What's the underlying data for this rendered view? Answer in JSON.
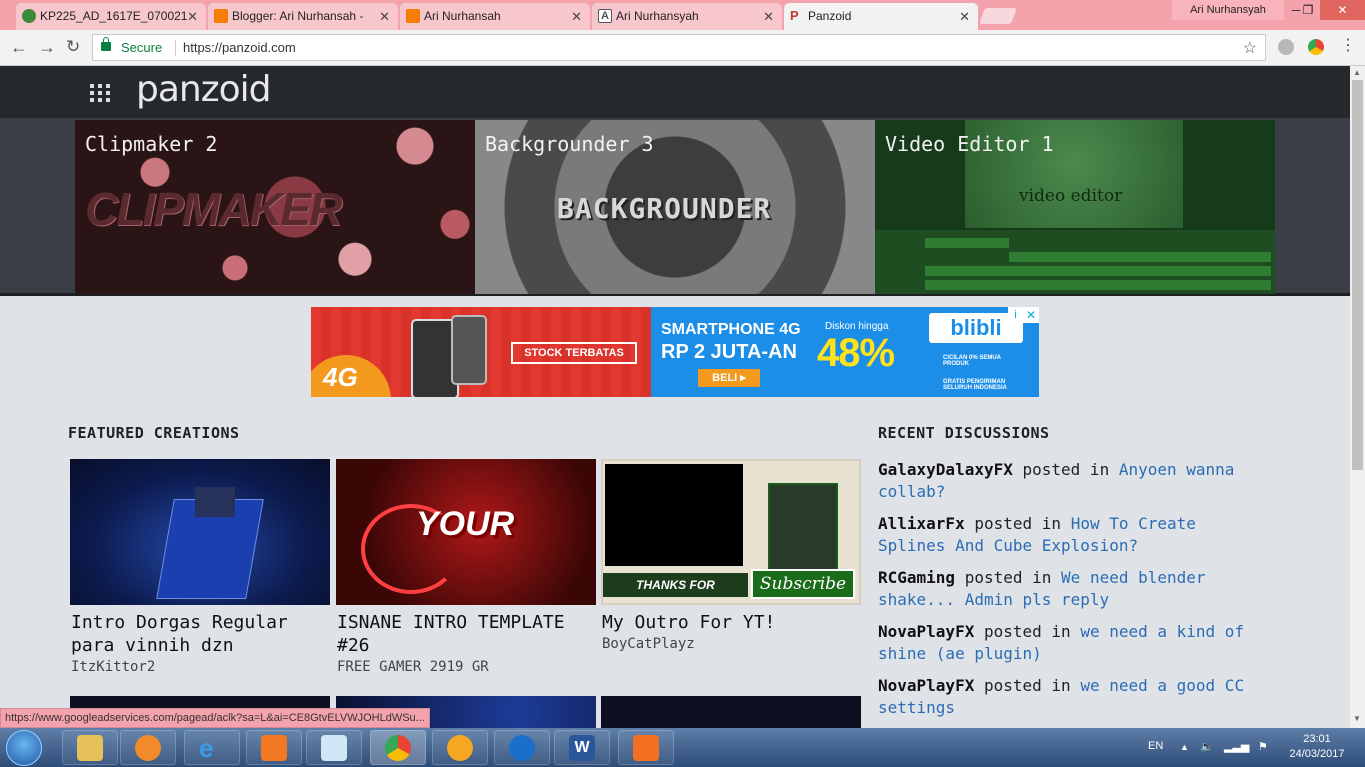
{
  "browser": {
    "tabs": [
      {
        "title": "KP225_AD_1617E_070021",
        "favicon": "moodle-favicon",
        "color": "#3a8a3a",
        "active": false
      },
      {
        "title": "Blogger: Ari Nurhansah -",
        "favicon": "blogger-favicon",
        "color": "#f57d00",
        "active": false
      },
      {
        "title": "Ari Nurhansah",
        "favicon": "blogger-favicon",
        "color": "#f57d00",
        "active": false
      },
      {
        "title": "Ari Nurhansyah",
        "favicon": "letter-a-favicon",
        "color": "#555555",
        "active": false
      },
      {
        "title": "Panzoid",
        "favicon": "panzoid-favicon",
        "color": "#c0392b",
        "active": true
      }
    ],
    "profile_name": "Ari Nurhansyah",
    "secure_label": "Secure",
    "url": "https://panzoid.com"
  },
  "site": {
    "logo": "panzoid",
    "tools": [
      {
        "title": "Clipmaker 2",
        "art_text": "CLIPMAKER"
      },
      {
        "title": "Backgrounder 3",
        "art_text": "BACKGROUNDER"
      },
      {
        "title": "Video Editor 1",
        "art_text": "video editor"
      }
    ]
  },
  "ad": {
    "badge": "4G",
    "stock": "STOCK TERBATAS",
    "headline1": "SMARTPHONE 4G",
    "headline2": "RP 2 JUTA-AN",
    "discount_label": "Diskon hingga",
    "discount": "48%",
    "cta": "BELI ▸",
    "brand": "blibli",
    "feature1": "CICILAN 0% SEMUA PRODUK",
    "feature2": "GRATIS PENGIRIMAN SELURUH INDONESIA",
    "info_icon": "i",
    "close_icon": "✕"
  },
  "featured": {
    "heading": "FEATURED CREATIONS",
    "cards": [
      {
        "title": "Intro Dorgas Regular para vinnih dzn",
        "author": "ItzKittor2"
      },
      {
        "title": "ISNANE INTRO TEMPLATE #26",
        "author": "FREE GAMER 2919 GR",
        "art_text": "YOUR"
      },
      {
        "title": "My Outro For YT!",
        "author": "BoyCatPlayz",
        "art_text": "THANKS FOR WATCHING!",
        "art_subscribe": "Subscribe"
      }
    ]
  },
  "discussions": {
    "heading": "RECENT DISCUSSIONS",
    "posted_in": "posted in",
    "items": [
      {
        "user": "GalaxyDalaxyFX",
        "topic": "Anyoen wanna collab?"
      },
      {
        "user": "AllixarFx",
        "topic": "How To Create Splines And Cube Explosion?"
      },
      {
        "user": "RCGaming",
        "topic": "We need blender shake... Admin pls reply"
      },
      {
        "user": "NovaPlayFX",
        "topic": "we need a kind of shine (ae plugin)"
      },
      {
        "user": "NovaPlayFX",
        "topic": "we need a good CC settings"
      }
    ]
  },
  "status_link": "https://www.googleadservices.com/pagead/aclk?sa=L&ai=CE8GtvELVWJOHLdWSu...",
  "taskbar": {
    "apps": [
      "file-explorer-icon",
      "media-player-icon",
      "internet-explorer-icon",
      "xampp-icon",
      "notepad-icon",
      "chrome-icon",
      "vlc-icon",
      "ccleaner-icon",
      "word-icon",
      "pdf-icon"
    ],
    "language": "EN",
    "time": "23:01",
    "date": "24/03/2017"
  }
}
